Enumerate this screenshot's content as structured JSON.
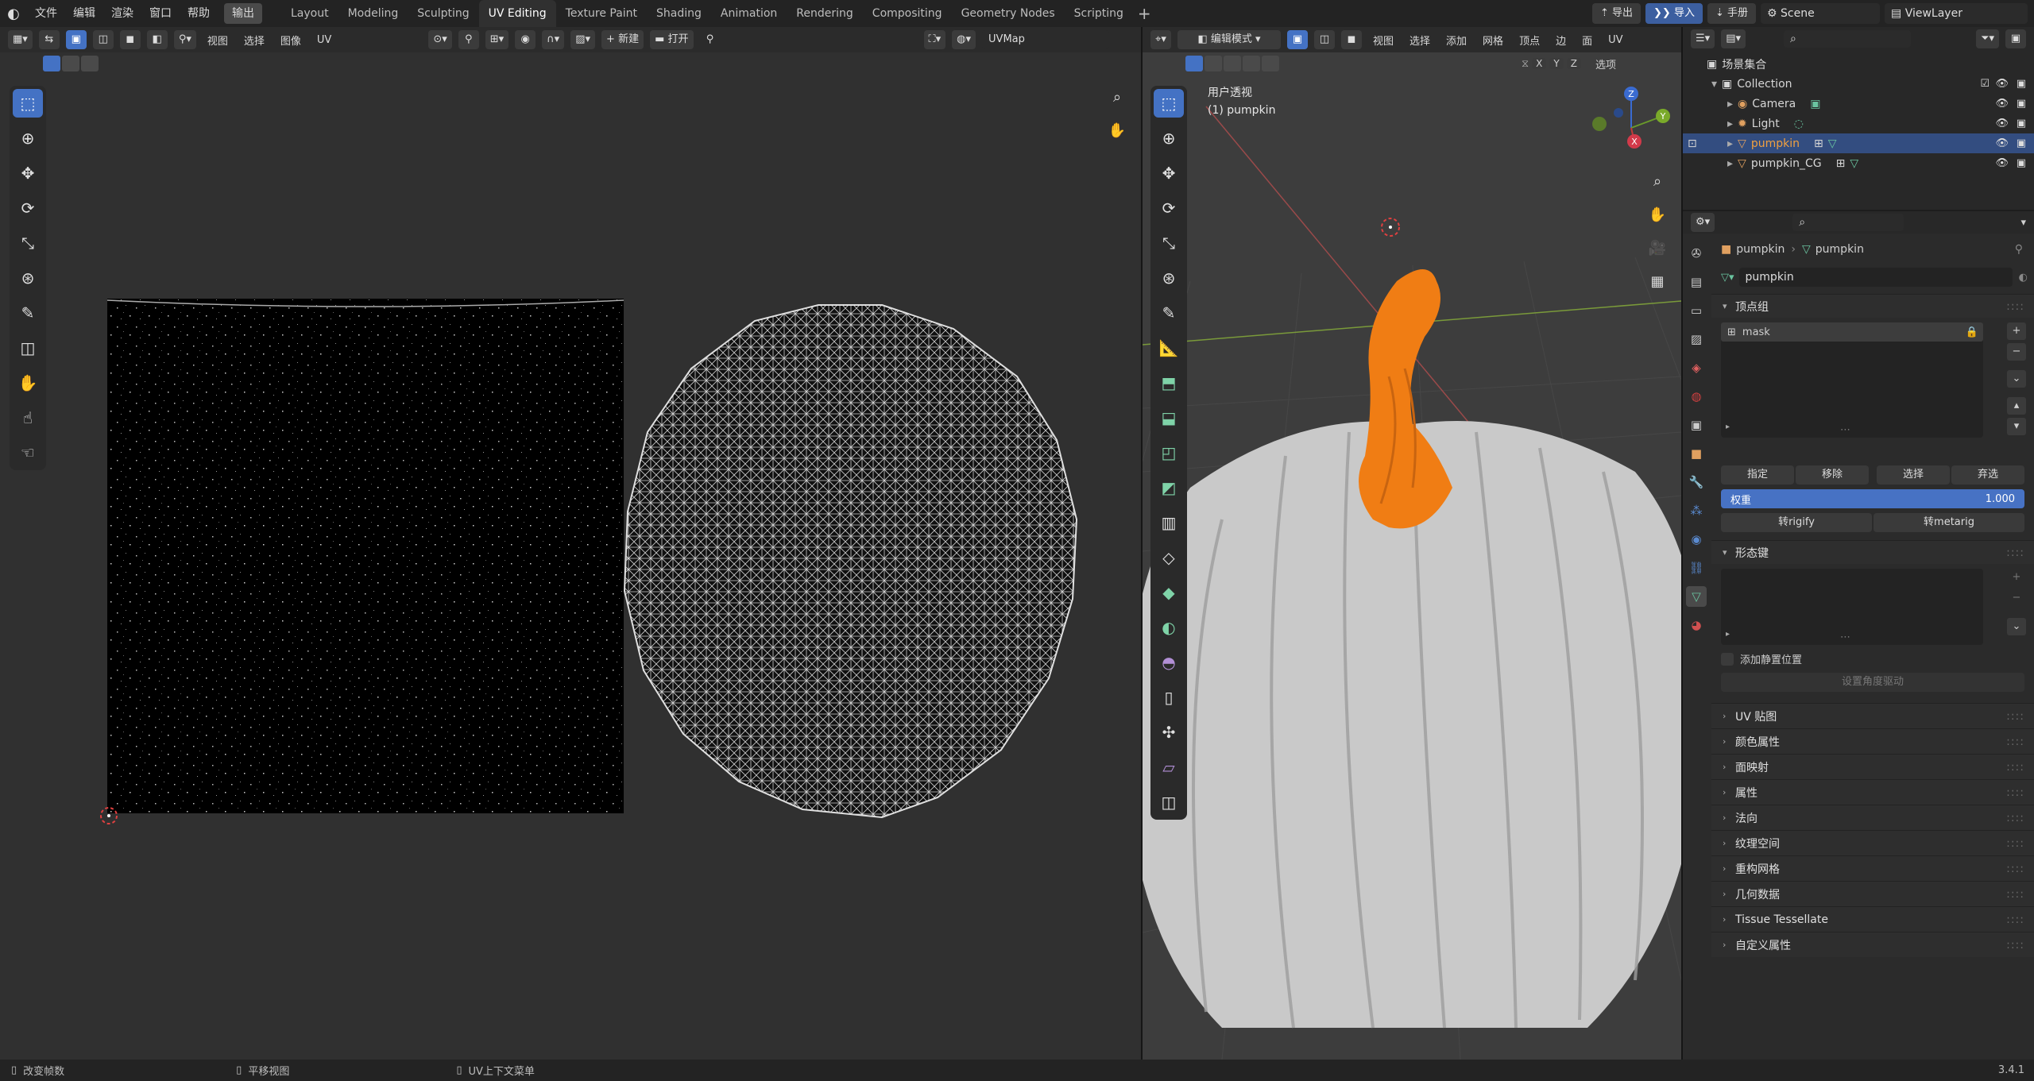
{
  "app": {
    "name": "Blender",
    "version": "3.4.1"
  },
  "menu": {
    "items": [
      "文件",
      "编辑",
      "渲染",
      "窗口",
      "帮助"
    ],
    "highlight": "输出"
  },
  "workspaces": {
    "tabs": [
      "Layout",
      "Modeling",
      "Sculpting",
      "UV Editing",
      "Texture Paint",
      "Shading",
      "Animation",
      "Rendering",
      "Compositing",
      "Geometry Nodes",
      "Scripting"
    ],
    "active": "UV Editing",
    "add_icon": "+"
  },
  "topright": {
    "export_label": "导出",
    "import_label": "导入",
    "manual_label": "手册",
    "scene": "Scene",
    "viewlayer": "ViewLayer"
  },
  "uv_editor": {
    "menus": [
      "视图",
      "选择",
      "图像",
      "UV"
    ],
    "new_label": "新建",
    "open_label": "打开",
    "uvmap": "UVMap"
  },
  "viewport": {
    "mode": "编辑模式",
    "menus": [
      "视图",
      "选择",
      "添加",
      "网格",
      "顶点",
      "边",
      "面",
      "UV"
    ],
    "axes": [
      "X",
      "Y",
      "Z"
    ],
    "options_label": "选项",
    "view_name": "用户透视",
    "object_label": "(1) pumpkin",
    "gizmo": {
      "x": "X",
      "y": "Y",
      "z": "Z"
    }
  },
  "outliner": {
    "root": "场景集合",
    "collection": "Collection",
    "objects": [
      {
        "name": "Camera",
        "icon": "camera-icon",
        "selected": false
      },
      {
        "name": "Light",
        "icon": "light-icon",
        "selected": false
      },
      {
        "name": "pumpkin",
        "icon": "mesh-icon",
        "selected": true
      },
      {
        "name": "pumpkin_CG",
        "icon": "mesh-icon",
        "selected": false
      }
    ]
  },
  "properties": {
    "breadcrumb_object": "pumpkin",
    "breadcrumb_data": "pumpkin",
    "mesh_name": "pumpkin",
    "vertex_groups": {
      "title": "顶点组",
      "items": [
        "mask"
      ],
      "assign": "指定",
      "remove": "移除",
      "select": "选择",
      "deselect": "弃选",
      "weight_label": "权重",
      "weight_value": "1.000",
      "to_rigify": "转rigify",
      "to_metarig": "转metarig"
    },
    "shape_keys": {
      "title": "形态键",
      "add_rest": "添加静置位置",
      "set_driver": "设置角度驱动"
    },
    "collapsed_panels": [
      "UV 贴图",
      "颜色属性",
      "面映射",
      "属性",
      "法向",
      "纹理空间",
      "重构网格",
      "几何数据",
      "Tissue Tessellate",
      "自定义属性"
    ]
  },
  "statusbar": {
    "left": "改变帧数",
    "middle": "平移视图",
    "right": "UV上下文菜单",
    "version": "3.4.1"
  },
  "colors": {
    "accent": "#4472c4",
    "selected_row": "#334d80",
    "pumpkin_stem": "#f07d14",
    "pumpkin_body": "#c9c9c9",
    "uv_background": "#303030",
    "viewport_background": "#3d3d3d"
  }
}
